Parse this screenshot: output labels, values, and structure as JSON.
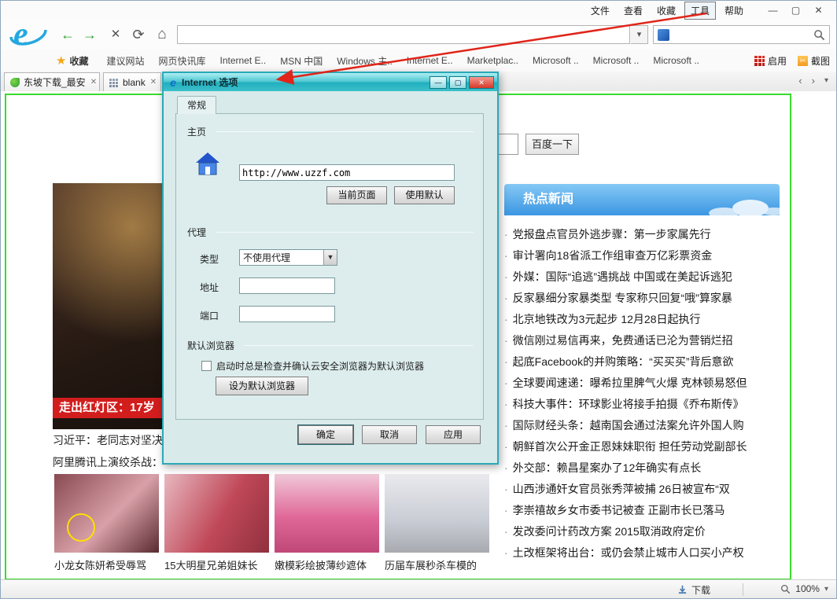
{
  "window": {
    "menu_items": [
      "文件",
      "查看",
      "收藏",
      "工具",
      "帮助"
    ]
  },
  "favorites_bar": {
    "favorites_label": "收藏",
    "links": [
      "建议网站",
      "网页快讯库",
      "Internet E..",
      "MSN 中国",
      "Windows 主..",
      "Internet E..",
      "Marketplac..",
      "Microsoft ..",
      "Microsoft ..",
      "Microsoft .."
    ],
    "enable_label": "启用",
    "capture_label": "截图"
  },
  "tab_bar": {
    "tabs": [
      {
        "label": "东坡下载_最安"
      },
      {
        "label": "blank"
      }
    ]
  },
  "dialog": {
    "title": "Internet 选项",
    "tab_general": "常规",
    "homepage_section": "主页",
    "homepage_url": "http://www.uzzf.com",
    "btn_current_page": "当前页面",
    "btn_use_default": "使用默认",
    "proxy_section": "代理",
    "type_label": "类型",
    "proxy_type_value": "不使用代理",
    "address_label": "地址",
    "port_label": "端口",
    "default_browser_section": "默认浏览器",
    "default_browser_checkbox": "启动时总是检查并确认云安全浏览器为默认浏览器",
    "btn_set_default": "设为默认浏览器",
    "btn_ok": "确定",
    "btn_cancel": "取消",
    "btn_apply": "应用"
  },
  "page": {
    "search_button": "百度一下",
    "hero_caption": "走出红灯区：17岁",
    "news_header": "热点新闻",
    "news_items": [
      "党报盘点官员外逃步骤：第一步家属先行",
      "审计署向18省派工作组审查万亿彩票资金",
      "外媒：国际“追逃”遇挑战 中国或在美起诉逃犯",
      "反家暴细分家暴类型 专家称只回复“哦”算家暴",
      "北京地铁改为3元起步 12月28日起执行",
      "微信刚过易信再来，免费通话已沦为营销烂招",
      "起底Facebook的并购策略：“买买买”背后意欲",
      "全球要闻速递：曝希拉里脾气火爆 克林顿易怒但",
      "科技大事件：环球影业将接手拍摄《乔布斯传》",
      "国际财经头条：越南国会通过法案允许外国人购",
      "朝鲜首次公开金正恩妹妹职衔 担任劳动党副部长",
      "外交部：赖昌星案办了12年确实有点长",
      "山西涉通奸女官员张秀萍被捕 26日被宣布“双",
      "李崇禧故乡女市委书记被查 正副市长已落马",
      "发改委问计药改方案 2015取消政府定价",
      "土改框架将出台：或仍会禁止城市人口买小产权"
    ],
    "left_headlines": [
      "习近平：老同志对坚决",
      "阿里腾讯上演绞杀战："
    ],
    "thumbs": [
      {
        "caption": "小龙女陈妍希受辱骂"
      },
      {
        "caption": "15大明星兄弟姐妹长"
      },
      {
        "caption": "嫩模彩绘披薄纱遮体"
      },
      {
        "caption": "历届车展秒杀车模的"
      }
    ]
  },
  "status_bar": {
    "download_label": "下载",
    "zoom_value": "100%"
  }
}
